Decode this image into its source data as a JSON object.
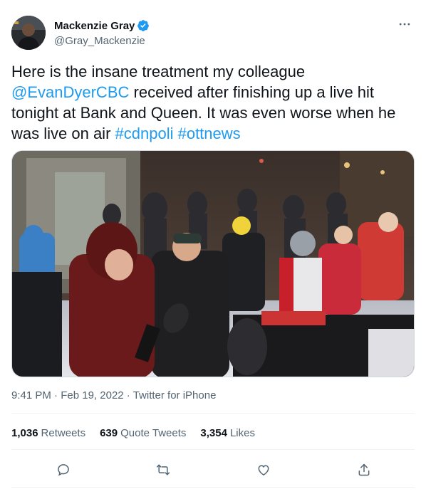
{
  "author": {
    "display_name": "Mackenzie Gray",
    "handle": "@Gray_Mackenzie",
    "verified": true
  },
  "tweet": {
    "text_1": "Here is the insane treatment my colleague ",
    "mention": "@EvanDyerCBC",
    "text_2": " received after finishing up a live hit tonight at Bank and Queen. It was even worse when he was live on air ",
    "hashtag_1": "#cdnpoli",
    "space": " ",
    "hashtag_2": "#ottnews"
  },
  "meta": {
    "time": "9:41 PM",
    "separator": " · ",
    "date": "Feb 19, 2022",
    "separator2": " · ",
    "source": "Twitter for iPhone"
  },
  "stats": {
    "retweets_count": "1,036",
    "retweets_label": "Retweets",
    "quotes_count": "639",
    "quotes_label": "Quote Tweets",
    "likes_count": "3,354",
    "likes_label": "Likes"
  },
  "icons": {
    "more": "more-icon",
    "reply": "reply-icon",
    "retweet": "retweet-icon",
    "like": "heart-icon",
    "share": "share-icon",
    "verified": "verified-badge-icon"
  },
  "colors": {
    "link": "#1d9bf0",
    "text": "#0f1419",
    "secondary": "#536471",
    "divider": "#eff3f4"
  }
}
